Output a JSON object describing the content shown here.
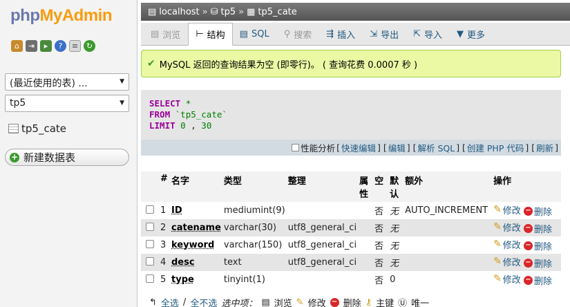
{
  "logo": {
    "part1": "php",
    "part2": "MyAdmin"
  },
  "nav": {
    "recent_select": "(最近使用的表) ...",
    "db_select": "tp5",
    "table_item": "tp5_cate",
    "new_table": "新建数据表"
  },
  "breadcrumb": {
    "server": "localhost",
    "db": "tp5",
    "table": "tp5_cate",
    "sep": "»"
  },
  "tabs": [
    {
      "label": "浏览"
    },
    {
      "label": "结构"
    },
    {
      "label": "SQL"
    },
    {
      "label": "搜索"
    },
    {
      "label": "插入"
    },
    {
      "label": "导出"
    },
    {
      "label": "导入"
    },
    {
      "label": "更多"
    }
  ],
  "message": "MySQL 返回的查询结果为空 (即零行)。 ( 查询花费 0.0007 秒 )",
  "sql": {
    "select": "SELECT",
    "star": "*",
    "from": "FROM",
    "table": "`tp5_cate`",
    "limit": "LIMIT",
    "lim_a": "0",
    "comma": ",",
    "lim_b": "30"
  },
  "sql_links": {
    "profile": "性能分析",
    "quick_edit": "快速编辑",
    "edit": "编辑",
    "explain": "解析 SQL",
    "create_php": "创建 PHP 代码",
    "refresh": "刷新"
  },
  "table_headers": {
    "num": "#",
    "name": "名字",
    "type": "类型",
    "collation": "整理",
    "attr1": "属",
    "attr2": "性",
    "null": "空",
    "def1": "默",
    "def2": "认",
    "extra": "额外",
    "action": "操作"
  },
  "rows": [
    {
      "num": "1",
      "name": "ID",
      "type": "mediumint(9)",
      "collation": "",
      "null": "否",
      "default": "无",
      "extra": "AUTO_INCREMENT"
    },
    {
      "num": "2",
      "name": "catename",
      "type": "varchar(30)",
      "collation": "utf8_general_ci",
      "null": "否",
      "default": "无",
      "extra": ""
    },
    {
      "num": "3",
      "name": "keyword",
      "type": "varchar(150)",
      "collation": "utf8_general_ci",
      "null": "否",
      "default": "无",
      "extra": ""
    },
    {
      "num": "4",
      "name": "desc",
      "type": "text",
      "collation": "utf8_general_ci",
      "null": "否",
      "default": "无",
      "extra": ""
    },
    {
      "num": "5",
      "name": "type",
      "type": "tinyint(1)",
      "collation": "",
      "null": "否",
      "default": "0",
      "extra": ""
    }
  ],
  "row_actions": {
    "edit": "修改",
    "delete": "删除"
  },
  "bulk": {
    "check_all": "全选",
    "slash": "/",
    "uncheck_all": "全不选",
    "with_selected": "选中项：",
    "browse": "浏览",
    "edit": "修改",
    "delete": "删除",
    "primary": "主键",
    "unique": "唯一"
  },
  "colors": {
    "accent": "#235a81",
    "success_bg": "#ebf8a4",
    "keyword": "#990099",
    "delete": "#d9262a"
  }
}
